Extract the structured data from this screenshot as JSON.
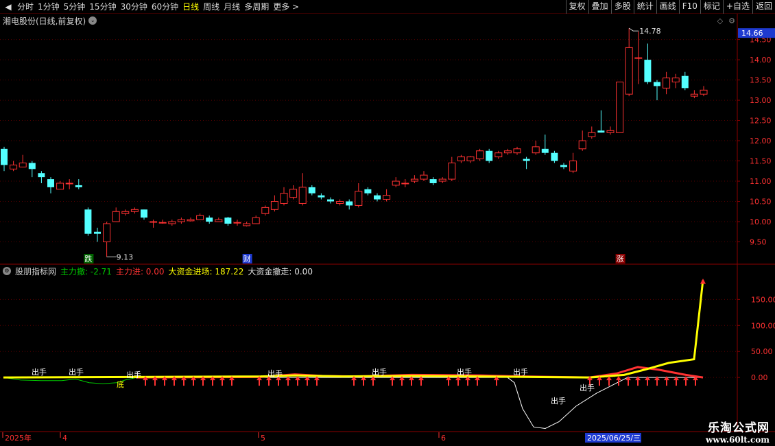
{
  "toolbar": {
    "back_icon": "back-arrow-icon",
    "periods": [
      "分时",
      "1分钟",
      "5分钟",
      "15分钟",
      "30分钟",
      "60分钟",
      "日线",
      "周线",
      "月线",
      "多周期",
      "更多 >"
    ],
    "active_period": "日线",
    "buttons": [
      "复权",
      "叠加",
      "多股",
      "统计",
      "画线",
      "F10",
      "标记",
      "+自选",
      "返回"
    ]
  },
  "main_chart": {
    "title": "湘电股份(日线,前复权)",
    "current_price": "14.66",
    "high_label": "14.78",
    "low_label": "9.13",
    "markers": [
      "跌",
      "财",
      "涨"
    ],
    "y_ticks": [
      "14.50",
      "14.00",
      "13.50",
      "13.00",
      "12.50",
      "12.00",
      "11.50",
      "11.00",
      "10.50",
      "10.00",
      "9.50"
    ],
    "colors": {
      "up": "#ff3232",
      "down": "#54ffff",
      "grid": "#8b0000"
    }
  },
  "indicator": {
    "name": "股朋指标网",
    "items": [
      {
        "label": "主力撤: -2.71",
        "color": "green"
      },
      {
        "label": "主力进: 0.00",
        "color": "red"
      },
      {
        "label": "大资金进场: 187.22",
        "color": "yellow"
      },
      {
        "label": "大资金撤走: 0.00",
        "color": "white"
      }
    ],
    "y_ticks": [
      "150.00",
      "100.00",
      "50.00",
      "0.00"
    ],
    "signal_text": "出手",
    "bottom_text": "底"
  },
  "date_axis": {
    "labels": [
      "2025年",
      "4",
      "5",
      "6"
    ],
    "cursor_date": "2025/06/25/三"
  },
  "watermark": {
    "line1": "乐淘公式网",
    "line2": "www.60lt.com"
  },
  "chart_data": {
    "type": "candlestick",
    "fields": [
      "open",
      "close",
      "high",
      "low"
    ],
    "candles": [
      [
        11.8,
        11.4,
        11.85,
        11.25
      ],
      [
        11.3,
        11.4,
        11.5,
        11.25
      ],
      [
        11.35,
        11.45,
        11.65,
        11.35
      ],
      [
        11.45,
        11.3,
        11.5,
        11.1
      ],
      [
        11.2,
        11.1,
        11.25,
        10.95
      ],
      [
        11.05,
        10.85,
        11.1,
        10.7
      ],
      [
        10.8,
        10.95,
        11.0,
        10.8
      ],
      [
        10.95,
        10.95,
        11.05,
        10.8
      ],
      [
        10.9,
        10.85,
        11.05,
        10.8
      ],
      [
        10.3,
        9.7,
        10.35,
        9.65
      ],
      [
        9.75,
        9.7,
        9.85,
        9.5
      ],
      [
        9.5,
        9.95,
        10.0,
        9.13
      ],
      [
        10.0,
        10.25,
        10.35,
        10.0
      ],
      [
        10.2,
        10.25,
        10.3,
        10.15
      ],
      [
        10.25,
        10.3,
        10.35,
        10.2
      ],
      [
        10.3,
        10.1,
        10.3,
        10.05
      ],
      [
        10.0,
        10.0,
        10.05,
        9.85
      ],
      [
        9.98,
        9.98,
        10.05,
        9.95
      ],
      [
        9.95,
        10.0,
        10.05,
        9.9
      ],
      [
        10.0,
        10.05,
        10.1,
        9.95
      ],
      [
        10.02,
        10.05,
        10.1,
        10.0
      ],
      [
        10.05,
        10.15,
        10.2,
        10.05
      ],
      [
        10.1,
        10.0,
        10.15,
        9.95
      ],
      [
        10.0,
        10.05,
        10.1,
        10.0
      ],
      [
        10.1,
        9.95,
        10.12,
        9.9
      ],
      [
        9.98,
        9.98,
        10.05,
        9.9
      ],
      [
        9.9,
        9.95,
        10.0,
        9.88
      ],
      [
        9.95,
        10.1,
        10.15,
        9.95
      ],
      [
        10.2,
        10.35,
        10.4,
        10.15
      ],
      [
        10.3,
        10.5,
        10.65,
        10.25
      ],
      [
        10.45,
        10.7,
        10.85,
        10.4
      ],
      [
        10.6,
        10.8,
        10.9,
        10.55
      ],
      [
        10.45,
        10.85,
        11.2,
        10.4
      ],
      [
        10.85,
        10.7,
        10.9,
        10.65
      ],
      [
        10.65,
        10.6,
        10.7,
        10.55
      ],
      [
        10.55,
        10.5,
        10.6,
        10.45
      ],
      [
        10.45,
        10.5,
        10.55,
        10.4
      ],
      [
        10.5,
        10.4,
        10.55,
        10.3
      ],
      [
        10.4,
        10.75,
        10.95,
        10.35
      ],
      [
        10.8,
        10.7,
        10.85,
        10.65
      ],
      [
        10.65,
        10.55,
        10.7,
        10.5
      ],
      [
        10.55,
        10.65,
        10.8,
        10.5
      ],
      [
        10.9,
        11.0,
        11.1,
        10.85
      ],
      [
        10.95,
        10.95,
        11.05,
        10.85
      ],
      [
        11.0,
        11.05,
        11.15,
        10.95
      ],
      [
        11.05,
        11.15,
        11.25,
        11.0
      ],
      [
        11.05,
        10.95,
        11.1,
        10.9
      ],
      [
        11.0,
        11.05,
        11.1,
        10.95
      ],
      [
        11.05,
        11.45,
        11.6,
        11.0
      ],
      [
        11.5,
        11.6,
        11.65,
        11.45
      ],
      [
        11.5,
        11.6,
        11.62,
        11.45
      ],
      [
        11.55,
        11.75,
        11.8,
        11.5
      ],
      [
        11.75,
        11.5,
        11.8,
        11.45
      ],
      [
        11.6,
        11.7,
        11.75,
        11.55
      ],
      [
        11.7,
        11.75,
        11.8,
        11.65
      ],
      [
        11.7,
        11.8,
        11.85,
        11.65
      ],
      [
        11.55,
        11.5,
        11.6,
        11.3
      ],
      [
        11.7,
        11.85,
        12.0,
        11.65
      ],
      [
        11.8,
        11.7,
        12.15,
        11.65
      ],
      [
        11.7,
        11.5,
        11.75,
        11.45
      ],
      [
        11.4,
        11.35,
        11.45,
        11.3
      ],
      [
        11.25,
        11.5,
        11.7,
        11.2
      ],
      [
        11.8,
        12.0,
        12.25,
        11.75
      ],
      [
        12.1,
        12.2,
        12.35,
        12.05
      ],
      [
        12.25,
        12.2,
        12.75,
        12.2
      ],
      [
        12.2,
        12.25,
        12.35,
        12.15
      ],
      [
        12.2,
        13.45,
        13.45,
        12.2
      ],
      [
        13.15,
        14.3,
        14.78,
        13.1
      ],
      [
        14.05,
        14.05,
        14.7,
        13.4
      ],
      [
        14.0,
        13.45,
        14.4,
        13.4
      ],
      [
        13.45,
        13.35,
        13.5,
        13.0
      ],
      [
        13.3,
        13.55,
        13.7,
        13.15
      ],
      [
        13.45,
        13.55,
        13.65,
        13.3
      ],
      [
        13.6,
        13.3,
        13.7,
        13.25
      ],
      [
        13.1,
        13.15,
        13.25,
        13.05
      ],
      [
        13.15,
        13.25,
        13.35,
        13.1
      ]
    ],
    "indicator_series": [
      {
        "name": "大资金进场",
        "color": "#ffff00",
        "points_y": [
          0,
          0,
          0,
          0,
          1,
          2,
          2,
          1,
          2,
          3,
          5,
          4,
          3,
          2,
          3,
          5,
          4,
          2,
          1,
          2,
          4,
          10,
          22,
          28,
          35,
          187.22
        ]
      },
      {
        "name": "主力撤",
        "color": "#00c800",
        "points_y": [
          0,
          -5,
          -8,
          -12,
          -15,
          -10,
          0
        ]
      },
      {
        "name": "主力进",
        "color": "#ff3232",
        "points_y": [
          0,
          3,
          8,
          10,
          5,
          3,
          5,
          6,
          4,
          3,
          5,
          20,
          15,
          8,
          0
        ]
      },
      {
        "name": "white-line",
        "color": "#ffffff",
        "points_y": [
          0,
          0,
          0,
          0,
          -70,
          -100,
          -90,
          -60,
          -30,
          0,
          0
        ]
      }
    ]
  }
}
